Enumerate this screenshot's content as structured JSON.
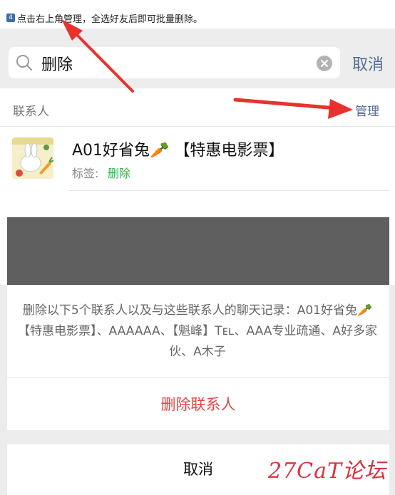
{
  "instruction": {
    "step_number": "4",
    "text": "点击右上角管理，全选好友后即可批量删除。"
  },
  "search": {
    "query": "删除",
    "cancel_label": "取消"
  },
  "section": {
    "title": "联系人",
    "manage_label": "管理"
  },
  "contact": {
    "name": "A01好省兔🥕 【特惠电影票】",
    "tag_prefix": "标签: ",
    "tag_value": "删除"
  },
  "action_sheet": {
    "message": "删除以下5个联系人以及与这些联系人的聊天记录：A01好省兔🥕【特惠电影票】、AAAAAA、【魁峰】Tᴇʟ、AAA专业疏通、A好多家伙、A木子",
    "delete_label": "删除联系人",
    "cancel_label": "取消"
  },
  "watermark": "27CaT论坛",
  "colors": {
    "link_blue": "#576b95",
    "tag_green": "#2eb44c",
    "danger_red": "#e64340",
    "arrow_red": "#e8322d"
  },
  "icons": [
    "search-icon",
    "clear-icon",
    "arrow-icon"
  ]
}
